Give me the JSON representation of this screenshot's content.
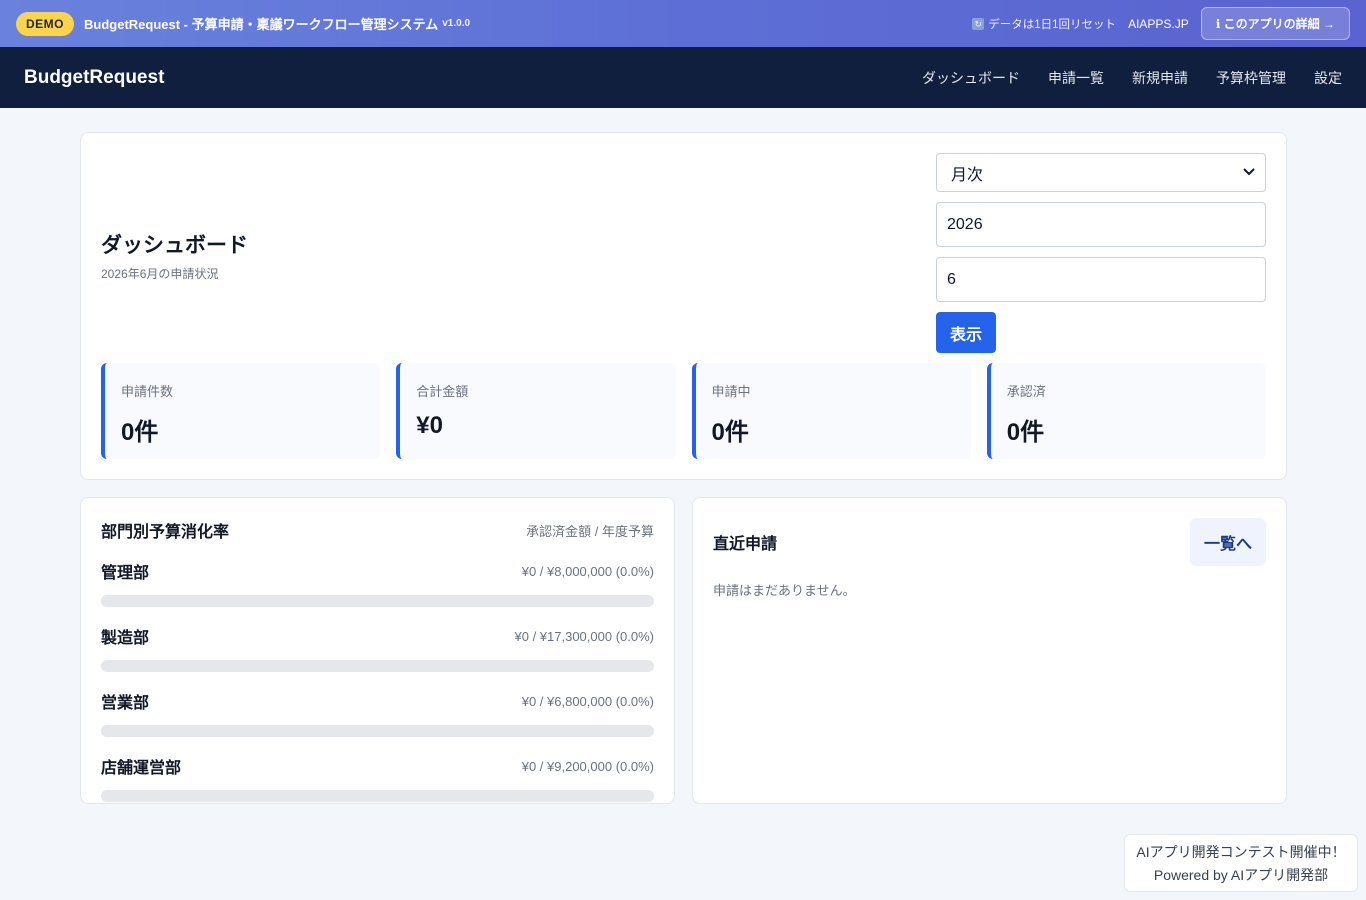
{
  "demo_bar": {
    "badge": "DEMO",
    "title": "BudgetRequest - 予算申請・稟議ワークフロー管理システム",
    "version": "v1.0.0",
    "reset_note": "データは1日1回リセット",
    "site_link": "AIAPPS.JP",
    "details_button": "ℹ このアプリの詳細 →"
  },
  "navbar": {
    "brand": "BudgetRequest",
    "items": [
      {
        "label": "ダッシュボード"
      },
      {
        "label": "申請一覧"
      },
      {
        "label": "新規申請"
      },
      {
        "label": "予算枠管理"
      },
      {
        "label": "設定"
      }
    ]
  },
  "dashboard": {
    "title": "ダッシュボード",
    "subtitle": "2026年6月の申請状況",
    "filters": {
      "period_selected": "月次",
      "year_value": "2026",
      "month_value": "6",
      "show_button": "表示"
    },
    "stats": [
      {
        "label": "申請件数",
        "value": "0件"
      },
      {
        "label": "合計金額",
        "value": "¥0"
      },
      {
        "label": "申請中",
        "value": "0件"
      },
      {
        "label": "承認済",
        "value": "0件"
      }
    ]
  },
  "budget_usage": {
    "title": "部門別予算消化率",
    "note": "承認済金額 / 年度予算",
    "departments": [
      {
        "name": "管理部",
        "amount": "¥0 / ¥8,000,000 (0.0%)",
        "progress": 0.0
      },
      {
        "name": "製造部",
        "amount": "¥0 / ¥17,300,000 (0.0%)",
        "progress": 0.0
      },
      {
        "name": "営業部",
        "amount": "¥0 / ¥6,800,000 (0.0%)",
        "progress": 0.0
      },
      {
        "name": "店舗運営部",
        "amount": "¥0 / ¥9,200,000 (0.0%)",
        "progress": 0.0
      }
    ]
  },
  "recent": {
    "title": "直近申請",
    "list_button": "一覧へ",
    "empty_text": "申請はまだありません。"
  },
  "promo": {
    "line1": "AIアプリ開発コンテスト開催中！",
    "line2": "Powered by AIアプリ開発部"
  },
  "colors": {
    "accent": "#2563eb",
    "navbar": "#0f1f3d",
    "badge": "#fcd34d"
  }
}
